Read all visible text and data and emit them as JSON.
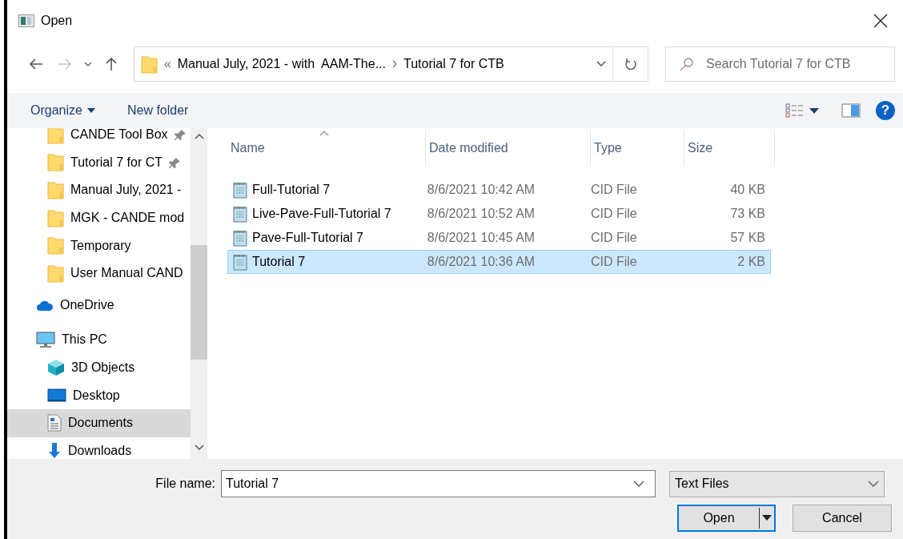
{
  "window": {
    "title": "Open"
  },
  "address": {
    "overflow_marker": "«",
    "crumbs": [
      "Manual July, 2021 - with  AAM-The...",
      "Tutorial 7 for CTB"
    ]
  },
  "search": {
    "placeholder": "Search Tutorial 7 for CTB"
  },
  "toolbar": {
    "buttons": [
      {
        "label": "Organize",
        "menu": true
      },
      {
        "label": "New folder",
        "menu": false
      }
    ],
    "help": "?"
  },
  "nav": {
    "quick_access": [
      {
        "label": "CANDE Tool Box",
        "pinned": true,
        "selected": false
      },
      {
        "label": "Tutorial 7 for CT",
        "pinned": true,
        "selected": false
      },
      {
        "label": "Manual July, 2021 -",
        "pinned": false,
        "selected": false
      },
      {
        "label": "MGK - CANDE mod",
        "pinned": false,
        "selected": false
      },
      {
        "label": "Temporary",
        "pinned": false,
        "selected": false
      },
      {
        "label": "User Manual CAND",
        "pinned": false,
        "selected": false
      }
    ],
    "items": [
      {
        "label": "OneDrive",
        "kind": "cloud",
        "selected": false
      },
      {
        "label": "This PC",
        "kind": "computer",
        "selected": false,
        "children": [
          {
            "label": "3D Objects",
            "kind": "cube",
            "selected": false
          },
          {
            "label": "Desktop",
            "kind": "desktop",
            "selected": false
          },
          {
            "label": "Documents",
            "kind": "documents",
            "selected": true
          },
          {
            "label": "Downloads",
            "kind": "downloads",
            "selected": false
          }
        ]
      }
    ]
  },
  "files": {
    "columns": [
      {
        "label": "Name",
        "sorted": true
      },
      {
        "label": "Date modified",
        "sorted": false
      },
      {
        "label": "Type",
        "sorted": false
      },
      {
        "label": "Size",
        "sorted": false
      }
    ],
    "rows": [
      {
        "name": "Full-Tutorial 7",
        "date": "8/6/2021 10:42 AM",
        "type": "CID File",
        "size": "40 KB",
        "selected": false
      },
      {
        "name": "Live-Pave-Full-Tutorial 7",
        "date": "8/6/2021 10:52 AM",
        "type": "CID File",
        "size": "73 KB",
        "selected": false
      },
      {
        "name": "Pave-Full-Tutorial 7",
        "date": "8/6/2021 10:45 AM",
        "type": "CID File",
        "size": "57 KB",
        "selected": false
      },
      {
        "name": "Tutorial 7",
        "date": "8/6/2021 10:36 AM",
        "type": "CID File",
        "size": "2 KB",
        "selected": true
      }
    ]
  },
  "footer": {
    "file_name": {
      "label": "File name:",
      "value": "Tutorial 7"
    },
    "file_type": {
      "value": "Text Files"
    },
    "buttons": [
      {
        "label": "Open",
        "kind": "split",
        "default": true
      },
      {
        "label": "Cancel",
        "kind": "plain",
        "default": false
      }
    ]
  }
}
